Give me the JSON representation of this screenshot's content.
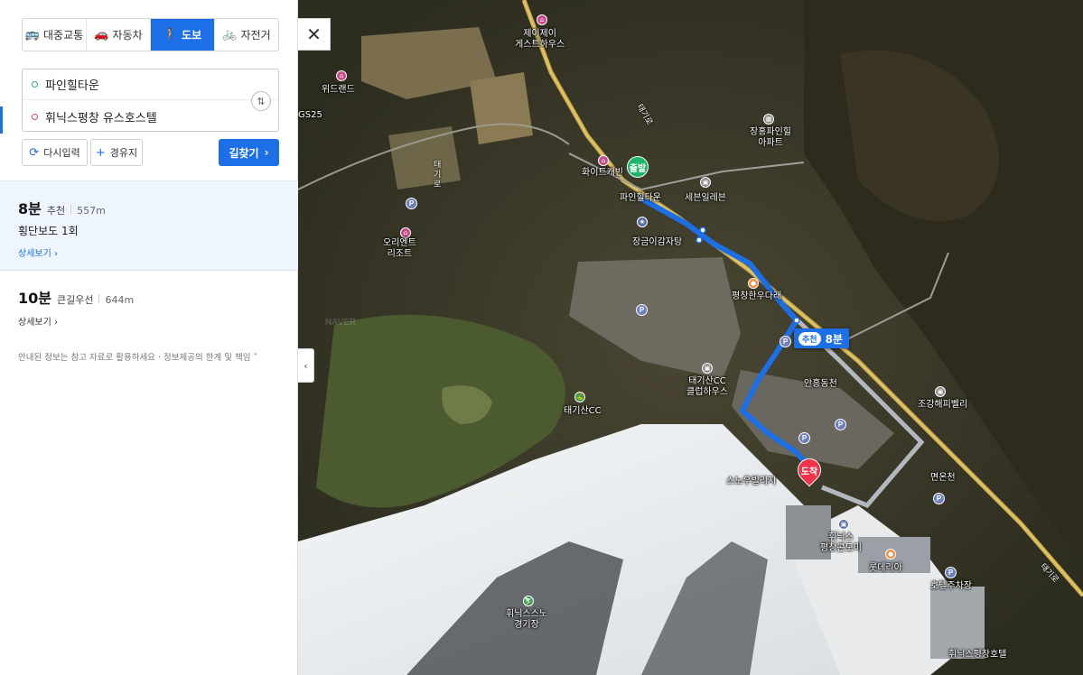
{
  "modes": [
    {
      "label": "대중교통",
      "icon": "bus-icon",
      "active": false
    },
    {
      "label": "자동차",
      "icon": "car-icon",
      "active": false
    },
    {
      "label": "도보",
      "icon": "walk-icon",
      "active": true
    },
    {
      "label": "자전거",
      "icon": "bicycle-icon",
      "active": false
    }
  ],
  "route": {
    "start": "파인힐타운",
    "end": "휘닉스평창 유스호스텔"
  },
  "buttons": {
    "reset": "다시입력",
    "waypoint": "경유지",
    "search": "길찾기"
  },
  "results": [
    {
      "time": "8분",
      "tag": "추천",
      "distance": "557m",
      "detail": "횡단보도 1회",
      "more": "상세보기"
    },
    {
      "time": "10분",
      "tag": "큰길우선",
      "distance": "644m",
      "more": "상세보기"
    }
  ],
  "notice": "안내된 정보는 참고 자료로 활용하세요 · 정보제공의 한계 및 책임",
  "map": {
    "start_marker": "출발",
    "end_marker": "도착",
    "route_badge_chip": "추천",
    "route_badge_time": "8분",
    "pois": {
      "jay_guesthouse": "제이제이\n게스트하우스",
      "windland": "위드랜드",
      "gs25": "GS25",
      "white_cabin": "화이트캐빈",
      "pinehill": "파인힐타운",
      "seven_eleven": "세븐일레븐",
      "jangsu": "장금이감자탕",
      "janghong": "장홍파인힐\n아파트",
      "orient": "오리엔트\n리조트",
      "pc_hanwoo": "평창한우다래",
      "taegisan_cc": "태기산CC\n클럽하우스",
      "taegisan_cc2": "태기산CC",
      "anheung": "안흥동천",
      "jogang": "조강해피벨리",
      "snow_village": "스노우빌리지",
      "phoenix_condo": "휘닉스\n평창콘도미",
      "lotteria": "롯데리아",
      "myeonon": "면온천",
      "hotel_parking": "호텔주차장",
      "snow_park": "휘닉스스노\n경기장",
      "youth_hostel": "휘닉스평창호텔"
    },
    "road_labels": {
      "taegiro": "태\n기\n로",
      "r1": "태기로",
      "r2": "태기로"
    },
    "watermark": "NAVER"
  }
}
